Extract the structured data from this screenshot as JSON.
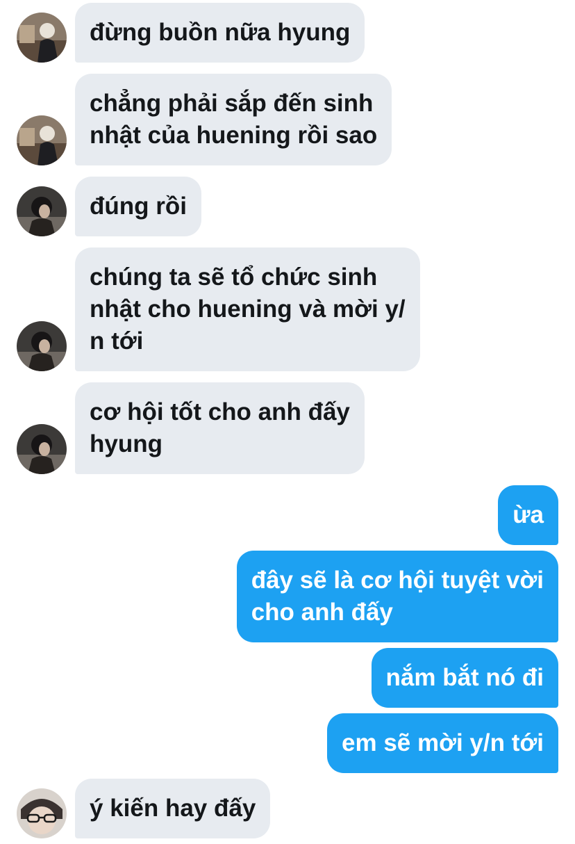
{
  "messages": [
    {
      "side": "incoming",
      "avatar": "avatar-a",
      "lines": [
        "đừng buồn nữa hyung"
      ]
    },
    {
      "side": "incoming",
      "avatar": "avatar-a",
      "lines": [
        "chẳng phải sắp đến sinh",
        "nhật của huening rồi sao"
      ]
    },
    {
      "side": "incoming",
      "avatar": "avatar-b",
      "lines": [
        "đúng rồi"
      ]
    },
    {
      "side": "incoming",
      "avatar": "avatar-b",
      "lines": [
        "chúng ta sẽ tổ chức sinh",
        "nhật cho huening và mời y/",
        "n tới"
      ]
    },
    {
      "side": "incoming",
      "avatar": "avatar-b",
      "lines": [
        "cơ hội tốt cho anh đấy",
        "hyung"
      ]
    },
    {
      "side": "outgoing",
      "lines": [
        "ừa"
      ]
    },
    {
      "side": "outgoing",
      "lines": [
        "đây sẽ là cơ hội tuyệt vời",
        "cho anh đấy"
      ]
    },
    {
      "side": "outgoing",
      "lines": [
        "nắm bắt nó đi"
      ]
    },
    {
      "side": "outgoing",
      "lines": [
        "em sẽ mời y/n tới"
      ]
    },
    {
      "side": "incoming",
      "avatar": "avatar-c",
      "lines": [
        "ý kiến hay đấy"
      ]
    }
  ],
  "colors": {
    "incoming_bubble": "#e7ebf0",
    "incoming_text": "#14171a",
    "outgoing_bubble": "#1da1f2",
    "outgoing_text": "#ffffff"
  }
}
